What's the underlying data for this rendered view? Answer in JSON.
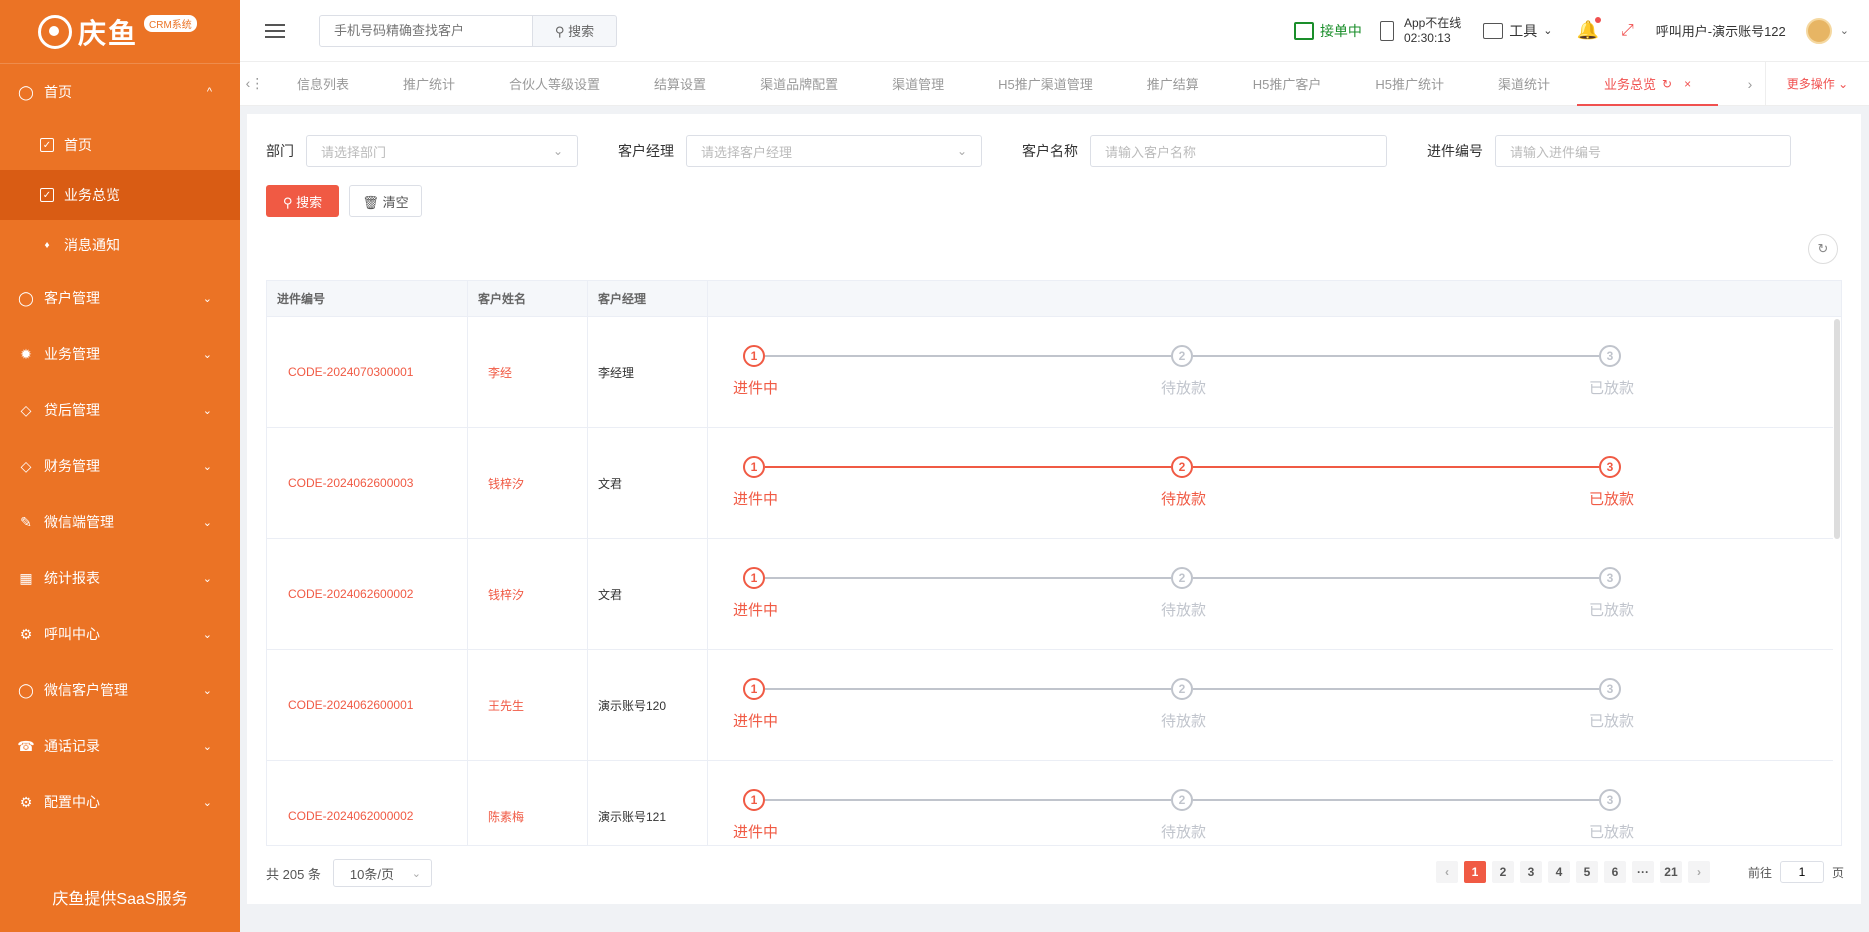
{
  "brand": {
    "name": "庆鱼",
    "badge": "CRM系统",
    "footer": "庆鱼提供SaaS服务"
  },
  "sidebar": {
    "menu": [
      {
        "label": "首页",
        "expanded": true,
        "chevron": "^"
      },
      {
        "label": "客户管理",
        "chevron": "⌄"
      },
      {
        "label": "业务管理",
        "chevron": "⌄"
      },
      {
        "label": "贷后管理",
        "chevron": "⌄"
      },
      {
        "label": "财务管理",
        "chevron": "⌄"
      },
      {
        "label": "微信端管理",
        "chevron": "⌄"
      },
      {
        "label": "统计报表",
        "chevron": "⌄"
      },
      {
        "label": "呼叫中心",
        "chevron": "⌄"
      },
      {
        "label": "微信客户管理",
        "chevron": "⌄"
      },
      {
        "label": "通话记录",
        "chevron": "⌄"
      },
      {
        "label": "配置中心",
        "chevron": "⌄"
      }
    ],
    "submenu": [
      {
        "label": "首页"
      },
      {
        "label": "业务总览"
      },
      {
        "label": "消息通知"
      }
    ]
  },
  "header": {
    "search_placeholder": "手机号码精确查找客户",
    "search_button": "搜索",
    "accept_label": "接单中",
    "app_status": "App不在线",
    "app_time": "02:30:13",
    "tools_label": "工具",
    "username": "呼叫用户-演示账号122"
  },
  "tabs": {
    "items": [
      "信息列表",
      "推广统计",
      "合伙人等级设置",
      "结算设置",
      "渠道品牌配置",
      "渠道管理",
      "H5推广渠道管理",
      "推广结算",
      "H5推广客户",
      "H5推广统计",
      "渠道统计",
      "业务总览"
    ],
    "active": "业务总览",
    "more": "更多操作 ⌄"
  },
  "filters": {
    "dept_label": "部门",
    "dept_placeholder": "请选择部门",
    "manager_label": "客户经理",
    "manager_placeholder": "请选择客户经理",
    "name_label": "客户名称",
    "name_placeholder": "请输入客户名称",
    "code_label": "进件编号",
    "code_placeholder": "请输入进件编号",
    "search_button": "搜索",
    "clear_button": "清空"
  },
  "table": {
    "columns": [
      "进件编号",
      "客户姓名",
      "客户经理",
      ""
    ],
    "steps": [
      "进件中",
      "待放款",
      "已放款"
    ],
    "rows": [
      {
        "code": "CODE-2024070300001",
        "name": "李经",
        "manager": "李经理",
        "progress": 1
      },
      {
        "code": "CODE-2024062600003",
        "name": "钱梓汐",
        "manager": "文君",
        "progress": 3
      },
      {
        "code": "CODE-2024062600002",
        "name": "钱梓汐",
        "manager": "文君",
        "progress": 1
      },
      {
        "code": "CODE-2024062600001",
        "name": "王先生",
        "manager": "演示账号120",
        "progress": 1
      },
      {
        "code": "CODE-2024062000002",
        "name": "陈素梅",
        "manager": "演示账号121",
        "progress": 1
      }
    ]
  },
  "pagination": {
    "total_text": "共 205 条",
    "page_size": "10条/页",
    "pages": [
      "1",
      "2",
      "3",
      "4",
      "5",
      "6",
      "···",
      "21"
    ],
    "current": "1",
    "goto_prefix": "前往",
    "goto_value": "1",
    "goto_suffix": "页"
  },
  "colors": {
    "sidebar": "#eb7325",
    "accent": "#f05a44",
    "accept": "#1a8e2a",
    "inactive": "#c0c4cc"
  }
}
